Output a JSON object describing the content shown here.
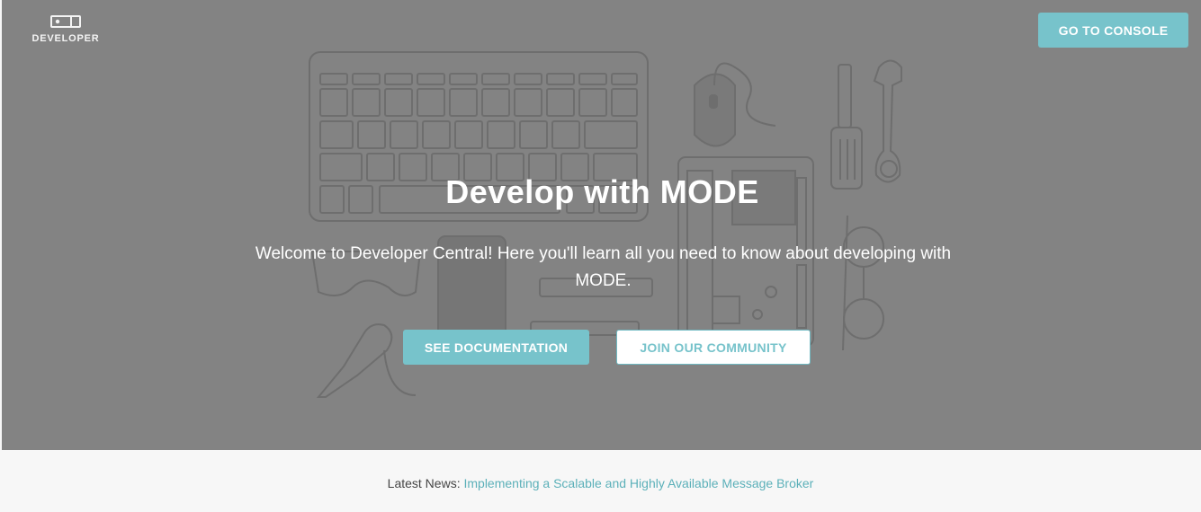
{
  "header": {
    "logo_text": "DEVELOPER",
    "console_button": "GO TO CONSOLE"
  },
  "hero": {
    "title": "Develop with MODE",
    "subtitle": "Welcome to Developer Central! Here you'll learn all you need to know about developing with MODE.",
    "docs_button": "SEE DOCUMENTATION",
    "community_button": "JOIN OUR COMMUNITY"
  },
  "news": {
    "label": "Latest News:",
    "link_text": "Implementing a Scalable and Highly Available Message Broker"
  },
  "colors": {
    "hero_background": "#838383",
    "accent": "#77c3cb",
    "link": "#5bb0b9",
    "footer_background": "#f7f7f7"
  }
}
